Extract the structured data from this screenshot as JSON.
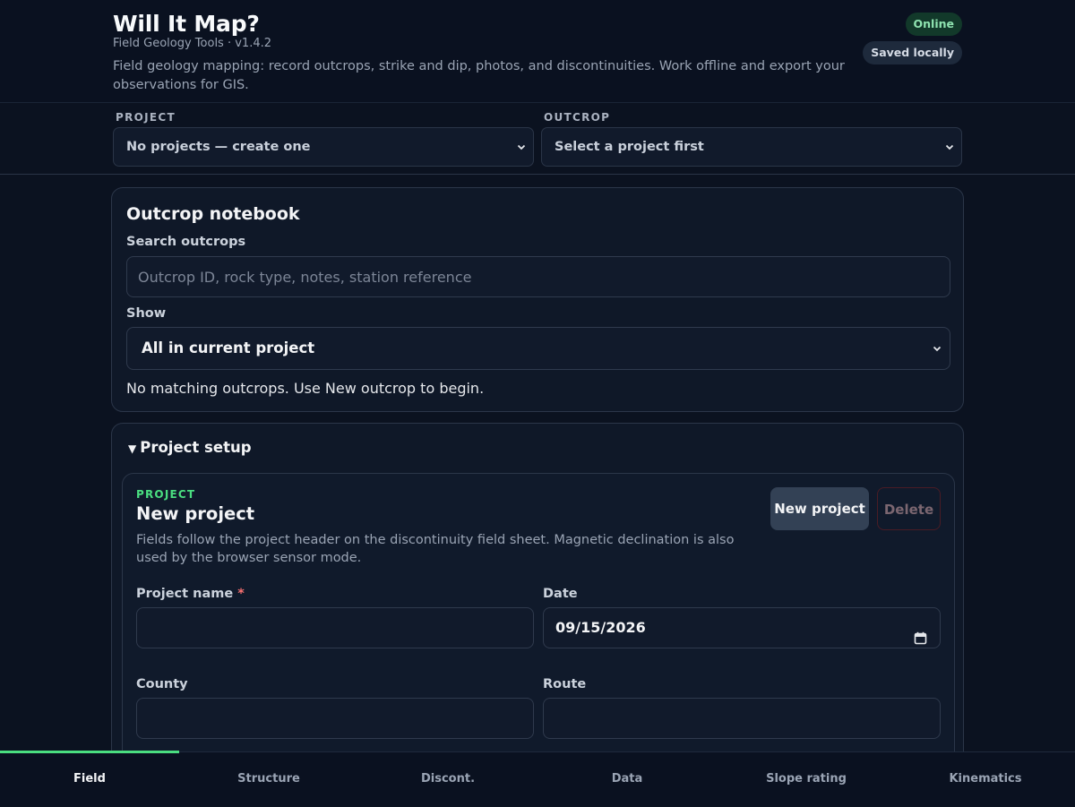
{
  "header": {
    "title": "Will It Map?",
    "subtitle": "Field Geology Tools · v1.4.2",
    "description": "Field geology mapping: record outcrops, strike and dip, photos, and discontinuities. Work offline and export your observations for GIS.",
    "badges": {
      "online": "Online",
      "saved": "Saved locally"
    }
  },
  "selectors": {
    "project_label": "PROJECT",
    "project_value": "No projects — create one",
    "outcrop_label": "OUTCROP",
    "outcrop_value": "Select a project first"
  },
  "notebook": {
    "heading": "Outcrop notebook",
    "search_label": "Search outcrops",
    "search_placeholder": "Outcrop ID, rock type, notes, station reference",
    "search_value": "",
    "show_label": "Show",
    "show_value": "All in current project",
    "empty_message": "No matching outcrops. Use New outcrop to begin."
  },
  "setup": {
    "summary": "Project setup",
    "kicker": "PROJECT",
    "title": "New project",
    "description": "Fields follow the project header on the discontinuity field sheet. Magnetic declination is also used by the browser sensor mode.",
    "new_button": "New project",
    "delete_button": "Delete",
    "fields": {
      "project_name_label": "Project name",
      "required_mark": "*",
      "project_name_value": "",
      "date_label": "Date",
      "date_value": "09/15/2026",
      "county_label": "County",
      "county_value": "",
      "route_label": "Route",
      "route_value": ""
    }
  },
  "tabs": [
    {
      "label": "Field",
      "active": true
    },
    {
      "label": "Structure",
      "active": false
    },
    {
      "label": "Discont.",
      "active": false
    },
    {
      "label": "Data",
      "active": false
    },
    {
      "label": "Slope rating",
      "active": false
    },
    {
      "label": "Kinematics",
      "active": false
    }
  ],
  "colors": {
    "background": "#0b1220",
    "accent": "#4ade80",
    "online_badge_bg": "#12392a",
    "danger": "#f87171"
  }
}
